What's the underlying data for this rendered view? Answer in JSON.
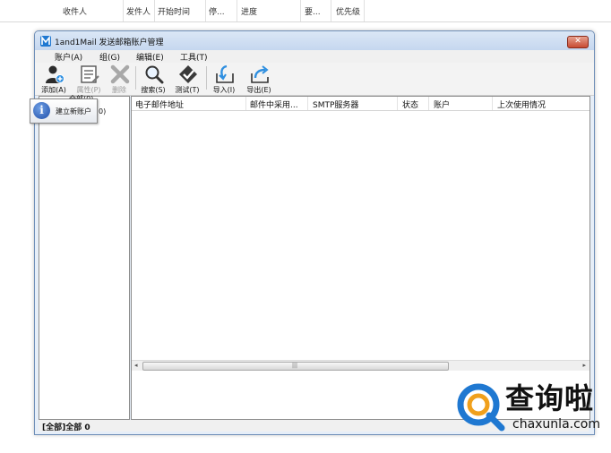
{
  "background_list": {
    "columns": [
      "收件人",
      "发件人",
      "开始时间",
      "停...",
      "进度",
      "要...",
      "优先级"
    ]
  },
  "window": {
    "title": "1and1Mail 发送邮箱账户管理",
    "close_label": "✕"
  },
  "menu": {
    "items": [
      {
        "label": "账户(A)"
      },
      {
        "label": "组(G)"
      },
      {
        "label": "编辑(E)"
      },
      {
        "label": "工具(T)"
      }
    ]
  },
  "toolbar": {
    "add": "添加(A)",
    "props": "属性(P)",
    "delete": "删除",
    "search": "搜索(S)",
    "test": "测试(T)",
    "import": "导入(I)",
    "export": "导出(E)"
  },
  "tree": {
    "root": "全部(0)",
    "partial": "0)"
  },
  "list": {
    "columns": [
      "电子邮件地址",
      "邮件中采用...",
      "SMTP服务器",
      "状态",
      "账户",
      "上次使用情况"
    ]
  },
  "scrollbar": {
    "grip": "|||",
    "left_arrow": "◂",
    "right_arrow": "▸"
  },
  "status": {
    "text": "[全部]全部 0"
  },
  "tooltip": {
    "icon_glyph": "i",
    "text": "建立新账户"
  },
  "watermark": {
    "cn": "查询啦",
    "en": "chaxunla.com"
  },
  "colors": {
    "accent_blue": "#1f78d1",
    "close_red": "#c84a33"
  }
}
